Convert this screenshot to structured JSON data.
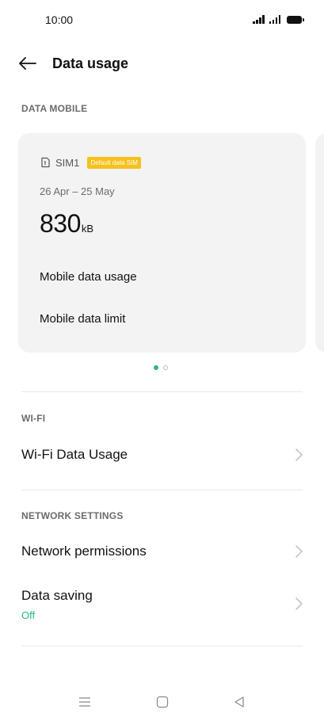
{
  "status_bar": {
    "time": "10:00"
  },
  "header": {
    "title": "Data usage"
  },
  "sections": {
    "mobile_label": "DATA MOBILE",
    "wifi_label": "WI-FI",
    "network_label": "NETWORK SETTINGS"
  },
  "sim_card": {
    "sim_name": "SIM1",
    "badge": "Default data SIM",
    "period": "26 Apr – 25 May",
    "usage_value": "830",
    "usage_unit": "kB",
    "mobile_data_usage": "Mobile data usage",
    "mobile_data_limit": "Mobile data limit"
  },
  "pager": {
    "total": 2,
    "active": 1
  },
  "wifi": {
    "item_label": "Wi-Fi Data Usage"
  },
  "network": {
    "permissions_label": "Network permissions",
    "data_saving_label": "Data saving",
    "data_saving_value": "Off"
  },
  "colors": {
    "accent": "#2ab77a",
    "badge": "#f5c11b",
    "card_bg": "#f3f3f3"
  },
  "icons": {
    "back": "arrow-left-icon",
    "sim": "sim-card-icon",
    "chevron": "chevron-right-icon",
    "nav_menu": "menu-icon",
    "nav_home": "home-square-icon",
    "nav_back": "back-triangle-icon"
  }
}
